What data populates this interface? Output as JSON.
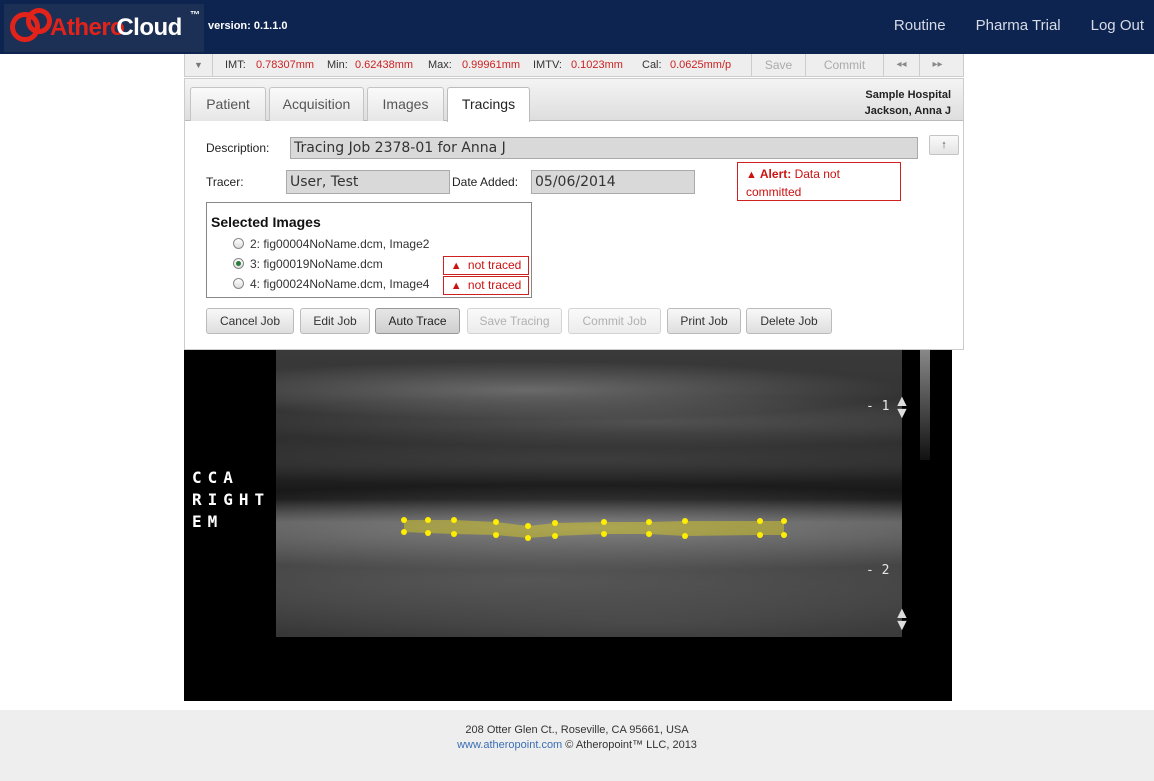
{
  "header": {
    "logo_part1": "Athero",
    "logo_part2": "Cloud",
    "logo_tm": "™",
    "version": "version: 0.1.1.0",
    "nav": [
      "Routine",
      "Pharma Trial",
      "Log Out"
    ]
  },
  "measurements": {
    "imt_label": "IMT:",
    "imt_value": "0.78307mm",
    "min_label": "Min:",
    "min_value": "0.62438mm",
    "max_label": "Max:",
    "max_value": "0.99961mm",
    "imtv_label": "IMTV:",
    "imtv_value": "0.1023mm",
    "cal_label": "Cal:",
    "cal_value": "0.0625mm/p",
    "save": "Save",
    "commit": "Commit",
    "prev": "◂◂",
    "next": "▸▸"
  },
  "tabs": [
    "Patient",
    "Acquisition",
    "Images",
    "Tracings"
  ],
  "active_tab": "Tracings",
  "hospital": {
    "name": "Sample Hospital",
    "patient": "Jackson, Anna J"
  },
  "form": {
    "description_label": "Description:",
    "description_value": "Tracing Job 2378-01 for Anna J",
    "tracer_label": "Tracer:",
    "tracer_value": "User, Test",
    "date_label": "Date Added:",
    "date_value": "05/06/2014"
  },
  "alert": {
    "title": "Alert:",
    "message": "Data not committed"
  },
  "selected_images": {
    "title": "Selected Images",
    "items": [
      {
        "label": "2: fig00004NoName.dcm, Image2",
        "selected": false,
        "status": ""
      },
      {
        "label": "3: fig00019NoName.dcm",
        "selected": true,
        "status": "not traced"
      },
      {
        "label": "4: fig00024NoName.dcm, Image4",
        "selected": false,
        "status": "not traced"
      }
    ]
  },
  "buttons": {
    "cancel": "Cancel Job",
    "edit": "Edit Job",
    "auto_trace": "Auto Trace",
    "save_tracing": "Save Tracing",
    "commit_job": "Commit Job",
    "print": "Print Job",
    "delete": "Delete Job"
  },
  "viewer": {
    "annotation_line1": "CCA",
    "annotation_line2": "RIGHT",
    "annotation_line3": "EM",
    "depth1": "- 1",
    "depth2": "- 2",
    "trace_color": "#ffee00"
  },
  "footer": {
    "address": "208 Otter Glen Ct., Roseville, CA 95661, USA",
    "link": "www.atheropoint.com",
    "copyright": " © Atheropoint™ LLC, 2013"
  }
}
